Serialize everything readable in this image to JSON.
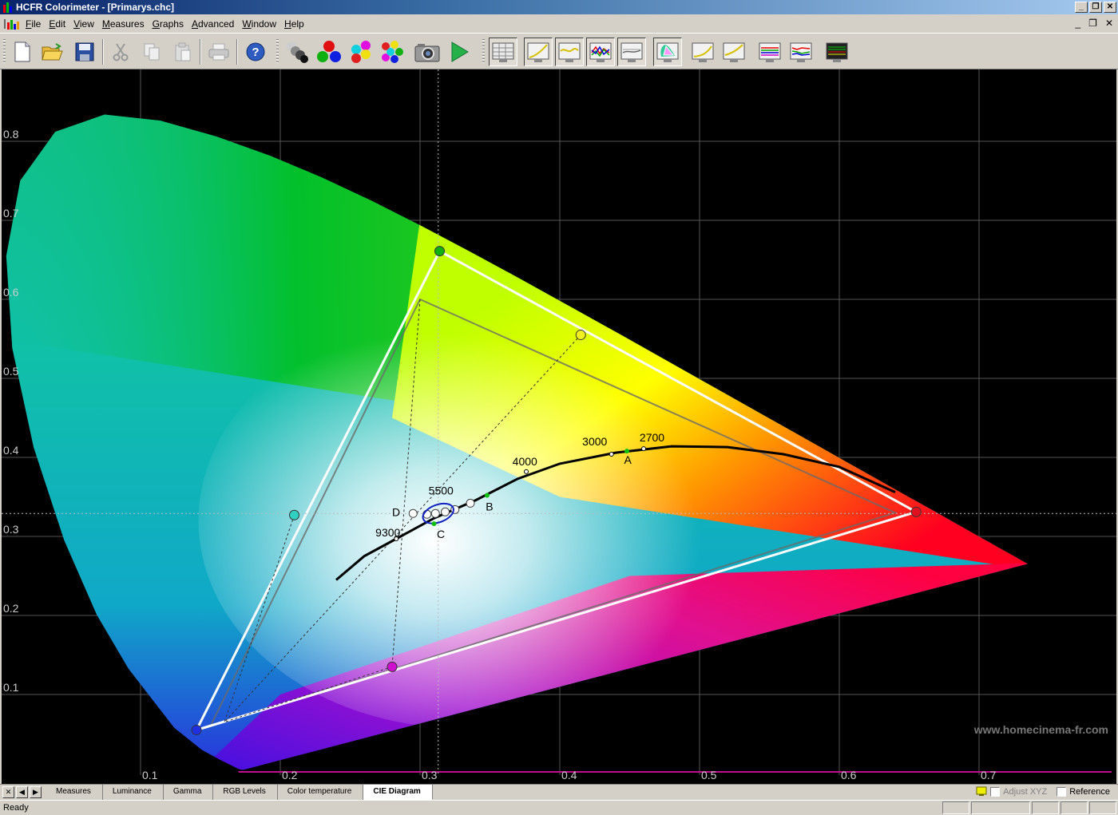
{
  "window": {
    "title": "HCFR Colorimeter - [Primarys.chc]"
  },
  "menu": [
    "File",
    "Edit",
    "View",
    "Measures",
    "Graphs",
    "Advanced",
    "Window",
    "Help"
  ],
  "mdi_buttons": [
    "_",
    "❐",
    "✕"
  ],
  "window_buttons": [
    "_",
    "❐",
    "✕"
  ],
  "toolbar": {
    "icons": [
      "new-document-icon",
      "open-folder-icon",
      "save-icon",
      "cut-icon",
      "copy-icon",
      "paste-icon",
      "print-icon",
      "help-icon",
      "grayscale-balls-icon",
      "rgb-balls-icon",
      "secondary-colors-balls-icon",
      "all-colors-balls-icon",
      "camera-icon",
      "play-icon",
      "measures-view-icon",
      "luminance-graph-icon",
      "gamma-graph-icon",
      "rgb-levels-graph-icon",
      "color-temperature-graph-icon",
      "cie-diagram-icon",
      "near-black-graph-icon",
      "near-white-graph-icon",
      "saturation-graph-icon",
      "saturation-shift-graph-icon",
      "measures-monitor-icon"
    ]
  },
  "plot": {
    "x_ticks": [
      "0.1",
      "0.2",
      "0.3",
      "0.4",
      "0.5",
      "0.6",
      "0.7"
    ],
    "y_ticks": [
      "0.8",
      "0.7",
      "0.6",
      "0.5",
      "0.4",
      "0.3",
      "0.2",
      "0.1"
    ],
    "cct_labels": [
      "9300",
      "5500",
      "4000",
      "3000",
      "2700"
    ],
    "illuminant_labels": [
      "A",
      "B",
      "C",
      "D"
    ],
    "watermark": "www.homecinema-fr.com",
    "colors": {
      "background": "#000000",
      "grid": "#555555",
      "gamut": "#ffffff",
      "locus": "#000000"
    }
  },
  "tabs": {
    "items": [
      "Measures",
      "Luminance",
      "Gamma",
      "RGB Levels",
      "Color temperature",
      "CIE Diagram"
    ],
    "active": "CIE Diagram",
    "adjust_xyz_label": "Adjust XYZ",
    "reference_label": "Reference"
  },
  "status": {
    "text": "Ready"
  }
}
